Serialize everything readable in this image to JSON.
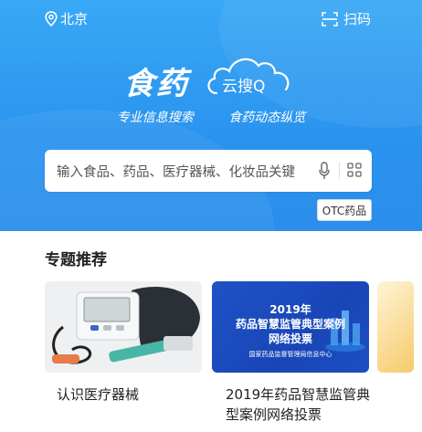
{
  "header": {
    "location": "北京",
    "scan_label": "扫码"
  },
  "logo": {
    "main": "食药",
    "sub": "云搜Q"
  },
  "tagline": {
    "left": "专业信息搜索",
    "right": "食药动态纵览"
  },
  "search": {
    "placeholder": "输入食品、药品、医疗器械、化妆品关键"
  },
  "otc_button": "OTC药品",
  "section": {
    "title": "专题推荐"
  },
  "cards": [
    {
      "caption": "认识医疗器械"
    },
    {
      "banner_line1": "2019年",
      "banner_line2": "药品智慧监管典型案例",
      "banner_line3": "网络投票",
      "banner_footer": "国家药品监督管理局信息中心",
      "caption": "2019年药品智慧监管典型案例网络投票"
    }
  ],
  "colors": {
    "hero_blue": "#2a93ef",
    "card_blue": "#1946b7"
  }
}
